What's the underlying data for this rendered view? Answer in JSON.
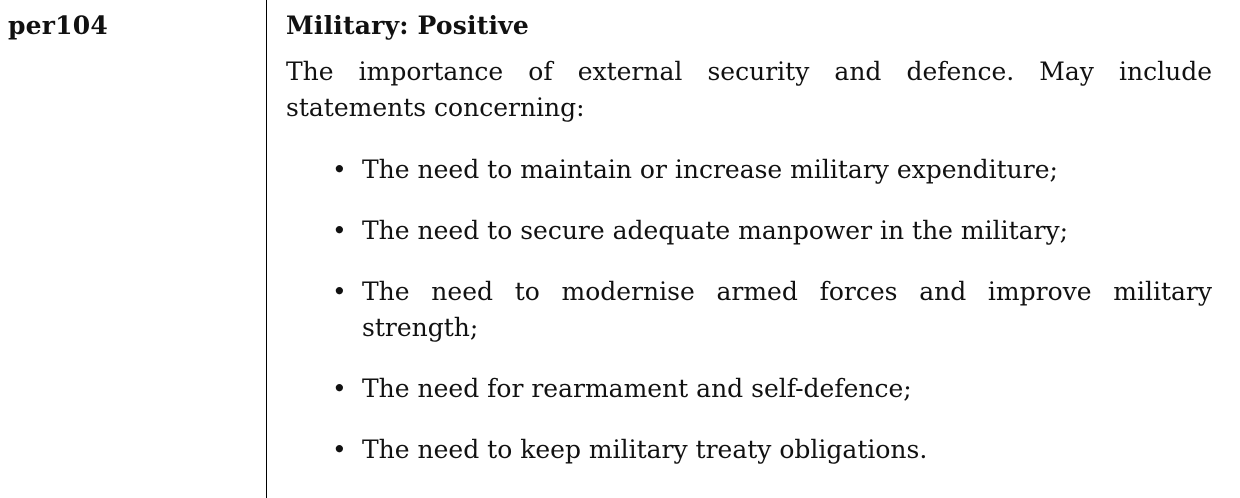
{
  "code": "per104",
  "title": "Military: Positive",
  "description": "The importance of external security and defence. May include statements concerning:",
  "bullet_glyph": "•",
  "items": [
    "The need to maintain or increase military expenditure;",
    "The need to secure adequate manpower in the military;",
    "The need to modernise armed forces and improve military strength;",
    "The need for rearmament and self-defence;",
    "The need to keep military treaty obligations."
  ]
}
